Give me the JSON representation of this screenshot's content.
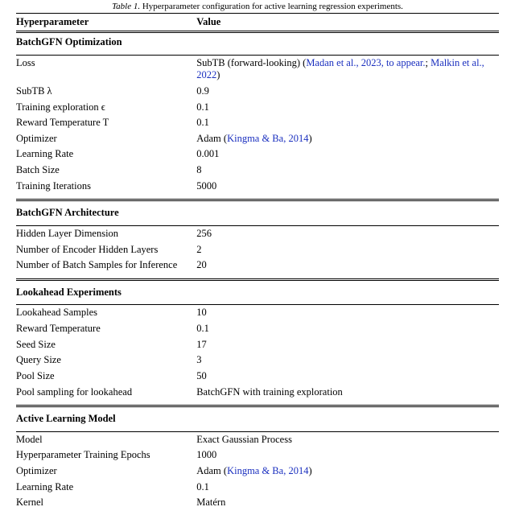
{
  "caption": {
    "label": "Table 1.",
    "text": "Hyperparameter configuration for active learning regression experiments."
  },
  "columns": {
    "hparam": "Hyperparameter",
    "value": "Value"
  },
  "sections": [
    {
      "title": "BatchGFN Optimization",
      "rows": [
        {
          "k": "Loss",
          "v_pre": "SubTB (forward-looking) (",
          "cite1": "Madan et al., 2023, to appear.",
          "mid": "; ",
          "cite2": "Malkin et al., 2022",
          "v_post": ")"
        },
        {
          "k": "SubTB λ",
          "v": "0.9"
        },
        {
          "k": "Training exploration ϵ",
          "v": "0.1"
        },
        {
          "k": "Reward Temperature T",
          "v": "0.1"
        },
        {
          "k": "Optimizer",
          "v_pre": "Adam (",
          "cite1": "Kingma & Ba, 2014",
          "v_post": ")"
        },
        {
          "k": "Learning Rate",
          "v": "0.001"
        },
        {
          "k": "Batch Size",
          "v": "8"
        },
        {
          "k": "Training Iterations",
          "v": "5000"
        }
      ]
    },
    {
      "title": "BatchGFN Architecture",
      "rows": [
        {
          "k": "Hidden Layer Dimension",
          "v": "256"
        },
        {
          "k": "Number of Encoder Hidden Layers",
          "v": "2"
        },
        {
          "k": "Number of Batch Samples for Inference",
          "v": "20"
        }
      ]
    },
    {
      "title": "Lookahead Experiments",
      "rows": [
        {
          "k": "Lookahead Samples",
          "v": "10"
        },
        {
          "k": "Reward Temperature",
          "v": "0.1"
        },
        {
          "k": "Seed Size",
          "v": "17"
        },
        {
          "k": "Query Size",
          "v": "3"
        },
        {
          "k": "Pool Size",
          "v": "50"
        },
        {
          "k": "Pool sampling for lookahead",
          "v": "BatchGFN with training exploration"
        }
      ]
    },
    {
      "title": "Active Learning Model",
      "rows": [
        {
          "k": "Model",
          "v": "Exact Gaussian Process"
        },
        {
          "k": "Hyperparameter Training Epochs",
          "v": "1000"
        },
        {
          "k": "Optimizer",
          "v_pre": "Adam (",
          "cite1": "Kingma & Ba, 2014",
          "v_post": ")"
        },
        {
          "k": "Learning Rate",
          "v": "0.1"
        },
        {
          "k": "Kernel",
          "v": "Matérn"
        }
      ]
    }
  ]
}
